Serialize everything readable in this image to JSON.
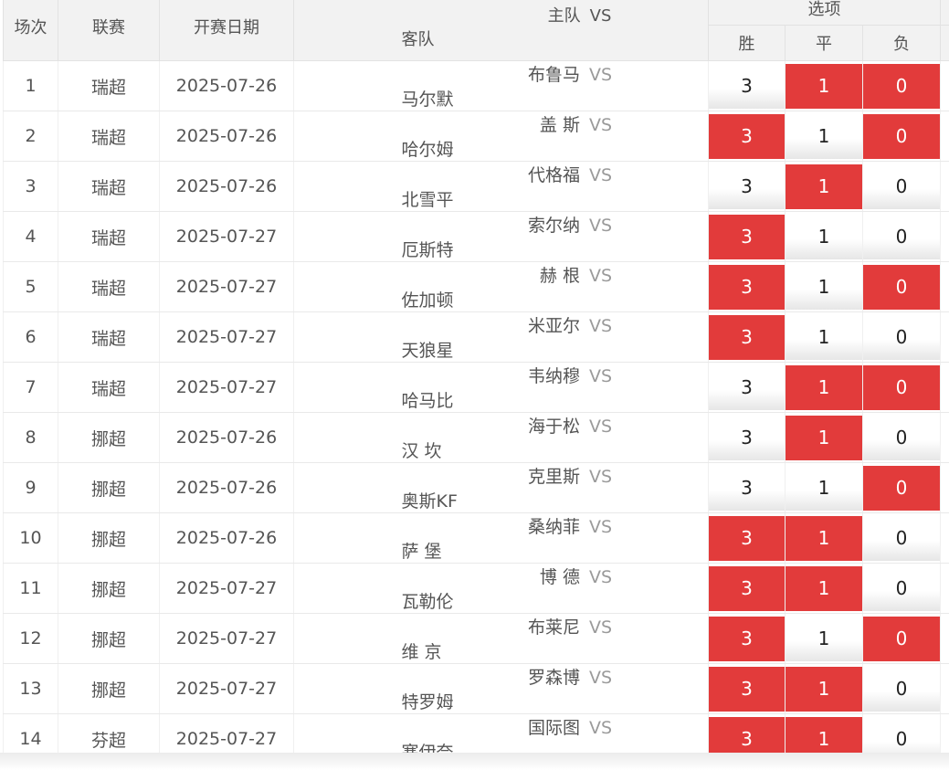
{
  "header": {
    "col_index": "场次",
    "col_league": "联赛",
    "col_date": "开赛日期",
    "col_home": "主队",
    "col_vs": "VS",
    "col_away": "客队",
    "options_group": "选项",
    "opt_win": "胜",
    "opt_draw": "平",
    "opt_loss": "负"
  },
  "vs_text": "VS",
  "colors": {
    "selected": "#e23b3b",
    "header_bg": "#f2f2f2"
  },
  "rows": [
    {
      "no": "1",
      "league": "瑞超",
      "date": "2025-07-26",
      "home": "布鲁马",
      "away": "马尔默",
      "opts": [
        "3",
        "1",
        "0"
      ],
      "selected": [
        false,
        true,
        true
      ]
    },
    {
      "no": "2",
      "league": "瑞超",
      "date": "2025-07-26",
      "home": "盖 斯",
      "away": "哈尔姆",
      "opts": [
        "3",
        "1",
        "0"
      ],
      "selected": [
        true,
        false,
        true
      ]
    },
    {
      "no": "3",
      "league": "瑞超",
      "date": "2025-07-26",
      "home": "代格福",
      "away": "北雪平",
      "opts": [
        "3",
        "1",
        "0"
      ],
      "selected": [
        false,
        true,
        false
      ]
    },
    {
      "no": "4",
      "league": "瑞超",
      "date": "2025-07-27",
      "home": "索尔纳",
      "away": "厄斯特",
      "opts": [
        "3",
        "1",
        "0"
      ],
      "selected": [
        true,
        false,
        false
      ]
    },
    {
      "no": "5",
      "league": "瑞超",
      "date": "2025-07-27",
      "home": "赫 根",
      "away": "佐加顿",
      "opts": [
        "3",
        "1",
        "0"
      ],
      "selected": [
        true,
        false,
        true
      ]
    },
    {
      "no": "6",
      "league": "瑞超",
      "date": "2025-07-27",
      "home": "米亚尔",
      "away": "天狼星",
      "opts": [
        "3",
        "1",
        "0"
      ],
      "selected": [
        true,
        false,
        false
      ]
    },
    {
      "no": "7",
      "league": "瑞超",
      "date": "2025-07-27",
      "home": "韦纳穆",
      "away": "哈马比",
      "opts": [
        "3",
        "1",
        "0"
      ],
      "selected": [
        false,
        true,
        true
      ]
    },
    {
      "no": "8",
      "league": "挪超",
      "date": "2025-07-26",
      "home": "海于松",
      "away": "汉 坎",
      "opts": [
        "3",
        "1",
        "0"
      ],
      "selected": [
        false,
        true,
        false
      ]
    },
    {
      "no": "9",
      "league": "挪超",
      "date": "2025-07-26",
      "home": "克里斯",
      "away": "奥斯KF",
      "opts": [
        "3",
        "1",
        "0"
      ],
      "selected": [
        false,
        false,
        true
      ]
    },
    {
      "no": "10",
      "league": "挪超",
      "date": "2025-07-26",
      "home": "桑纳菲",
      "away": "萨 堡",
      "opts": [
        "3",
        "1",
        "0"
      ],
      "selected": [
        true,
        true,
        false
      ]
    },
    {
      "no": "11",
      "league": "挪超",
      "date": "2025-07-27",
      "home": "博 德",
      "away": "瓦勒伦",
      "opts": [
        "3",
        "1",
        "0"
      ],
      "selected": [
        true,
        true,
        false
      ]
    },
    {
      "no": "12",
      "league": "挪超",
      "date": "2025-07-27",
      "home": "布莱尼",
      "away": "维 京",
      "opts": [
        "3",
        "1",
        "0"
      ],
      "selected": [
        true,
        false,
        true
      ]
    },
    {
      "no": "13",
      "league": "挪超",
      "date": "2025-07-27",
      "home": "罗森博",
      "away": "特罗姆",
      "opts": [
        "3",
        "1",
        "0"
      ],
      "selected": [
        true,
        true,
        false
      ]
    },
    {
      "no": "14",
      "league": "芬超",
      "date": "2025-07-27",
      "home": "国际图",
      "away": "塞伊奈",
      "opts": [
        "3",
        "1",
        "0"
      ],
      "selected": [
        true,
        true,
        false
      ]
    }
  ]
}
